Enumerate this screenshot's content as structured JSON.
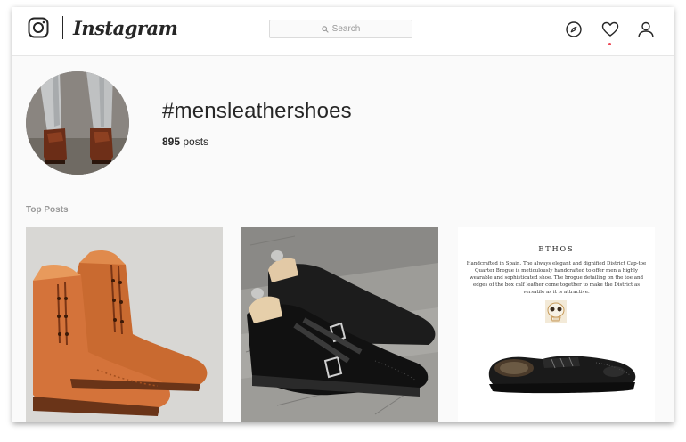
{
  "header": {
    "brand": "Instagram",
    "search_placeholder": "Search",
    "icons": [
      "instagram-camera-icon",
      "compass-icon",
      "heart-icon",
      "user-icon"
    ],
    "notification_color": "#ed4956"
  },
  "profile": {
    "hashtag": "#mensleathershoes",
    "post_count": "895",
    "post_count_suffix": "posts"
  },
  "sections": {
    "top_posts_label": "Top Posts"
  },
  "posts": [
    {
      "alt": "tan leather brogue boots"
    },
    {
      "alt": "black double monk strap shoes"
    },
    {
      "brand": "ETHOS",
      "caption": "Handcrafted in Spain. The always elegant and dignified District Cap-toe Quarter Brogue is meticulously handcrafted to offer men a highly wearable and sophisticated shoe. The brogue detailing on the toe and edges of the box calf leather come together to make the District as versatile as it is attractive."
    }
  ],
  "colors": {
    "text": "#262626",
    "muted": "#999999",
    "border": "#dbdbdb",
    "background": "#fafafa"
  }
}
